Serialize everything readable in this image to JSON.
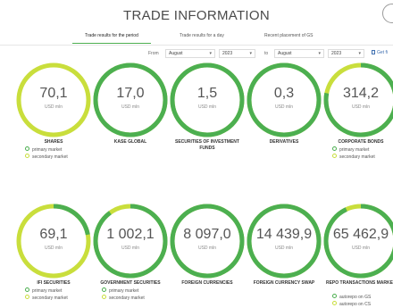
{
  "header": {
    "title": "TRADE INFORMATION"
  },
  "tabs": [
    {
      "label": "Trade results for the period",
      "active": true
    },
    {
      "label": "Trade results for a day",
      "active": false
    },
    {
      "label": "Recent placement of GS",
      "active": false
    }
  ],
  "filters": {
    "from_label": "From",
    "from_month": "August",
    "from_year": "2023",
    "to_label": "to",
    "to_month": "August",
    "to_year": "2023",
    "get_file_label": "Get fi"
  },
  "colors": {
    "primary": "#4caf50",
    "secondary": "#c9de3c",
    "track": "#e9f0da"
  },
  "unit": "USD mln",
  "legend_labels": {
    "primary": "primary market",
    "secondary": "secondary market",
    "autorepo_gs": "autorepo on GS",
    "autorepo_cs": "autorepo on CS"
  },
  "cards": [
    {
      "value": "70,1",
      "name": "SHARES",
      "legend": [
        "primary market",
        "secondary market"
      ],
      "primary_share": 0.0
    },
    {
      "value": "17,0",
      "name": "KASE GLOBAL",
      "legend": [],
      "primary_share": 1.0
    },
    {
      "value": "1,5",
      "name": "SECURITIES OF INVESTMENT FUNDS",
      "legend": [],
      "primary_share": 1.0
    },
    {
      "value": "0,3",
      "name": "DERIVATIVES",
      "legend": [],
      "primary_share": 1.0
    },
    {
      "value": "314,2",
      "name": "CORPORATE BONDS",
      "legend": [
        "primary market",
        "secondary market"
      ],
      "primary_share": 0.78
    },
    {
      "value": "69,1",
      "name": "IFI SECURITIES",
      "legend": [
        "primary market",
        "secondary market"
      ],
      "primary_share": 0.22
    },
    {
      "value": "1 002,1",
      "name": "GOVERNMENT SECURITIES",
      "legend": [
        "primary market",
        "secondary market"
      ],
      "primary_share": 0.9
    },
    {
      "value": "8 097,0",
      "name": "FOREIGN CURRENCIES",
      "legend": [],
      "primary_share": 1.0
    },
    {
      "value": "14 439,9",
      "name": "FOREIGN CURRENCY SWAP",
      "legend": [],
      "primary_share": 1.0
    },
    {
      "value": "65 462,9",
      "name": "REPO TRANSACTIONS MARKET",
      "legend": [
        "autorepo on GS",
        "autorepo on CS"
      ],
      "primary_share": 0.93
    }
  ]
}
